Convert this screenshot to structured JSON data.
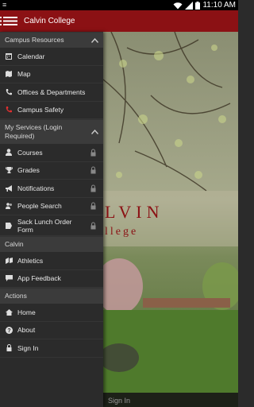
{
  "status_bar": {
    "time": "11:10 AM",
    "icons": [
      "wifi-icon",
      "signal-icon",
      "battery-icon"
    ]
  },
  "app_bar": {
    "title": "Calvin College"
  },
  "background": {
    "sign_in_label": "Sign In",
    "banner_text": "LVIN",
    "banner_subtext": "llege"
  },
  "drawer": {
    "sections": [
      {
        "title": "Campus Resources",
        "items": [
          {
            "label": "Calendar",
            "icon": "calendar-icon",
            "locked": false
          },
          {
            "label": "Map",
            "icon": "map-icon",
            "locked": false
          },
          {
            "label": "Offices & Departments",
            "icon": "phone-icon",
            "locked": false
          },
          {
            "label": "Campus Safety",
            "icon": "phone-icon",
            "locked": false
          }
        ]
      },
      {
        "title": "My Services (Login Required)",
        "items": [
          {
            "label": "Courses",
            "icon": "person-icon",
            "locked": true
          },
          {
            "label": "Grades",
            "icon": "trophy-icon",
            "locked": true
          },
          {
            "label": "Notifications",
            "icon": "megaphone-icon",
            "locked": true
          },
          {
            "label": "People Search",
            "icon": "people-icon",
            "locked": true
          },
          {
            "label": "Sack Lunch Order Form",
            "icon": "form-icon",
            "locked": true
          }
        ]
      },
      {
        "title": "Calvin",
        "items": [
          {
            "label": "Athletics",
            "icon": "athletics-icon",
            "locked": false
          },
          {
            "label": "App Feedback",
            "icon": "feedback-icon",
            "locked": false
          }
        ]
      },
      {
        "title": "Actions",
        "items": [
          {
            "label": "Home",
            "icon": "home-icon",
            "locked": false
          },
          {
            "label": "About",
            "icon": "help-icon",
            "locked": false
          },
          {
            "label": "Sign In",
            "icon": "lock-icon",
            "locked": false
          }
        ]
      }
    ]
  },
  "colors": {
    "app_bar": "#8b1114",
    "drawer_bg": "#2b2b2b",
    "section_header_bg": "#3b3b3b",
    "safety_icon": "#e03030"
  }
}
